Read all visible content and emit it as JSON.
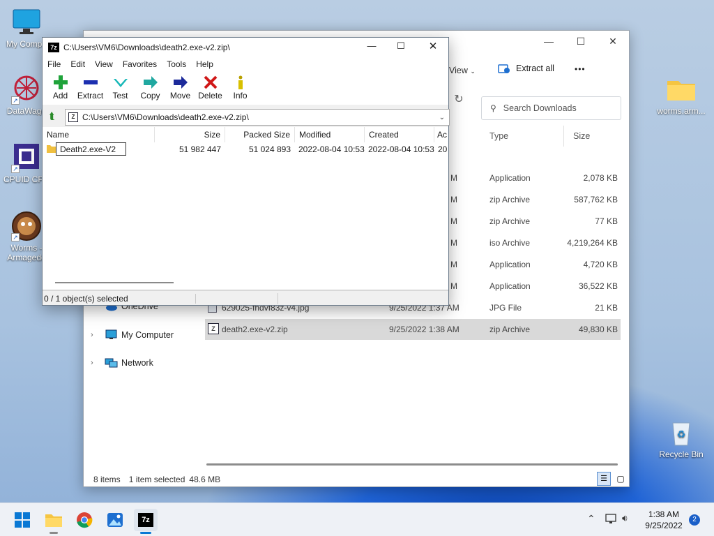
{
  "desktop": {
    "icons": [
      {
        "label": "My Compu"
      },
      {
        "label": "DataWago"
      },
      {
        "label": "CPUID CPU"
      },
      {
        "label": "Worms -"
      },
      {
        "label": "Armagedd"
      },
      {
        "label": "worms.arm..."
      },
      {
        "label": "Recycle Bin"
      }
    ]
  },
  "explorer": {
    "view_label": "View",
    "extract_all_label": "Extract all",
    "more_label": "•••",
    "search_placeholder": "Search Downloads",
    "columns": {
      "type": "Type",
      "size": "Size"
    },
    "rows": [
      {
        "date_tail": "M",
        "type": "Application",
        "size": "2,078 KB"
      },
      {
        "date_tail": "M",
        "type": "zip Archive",
        "size": "587,762 KB"
      },
      {
        "date_tail": "M",
        "type": "zip Archive",
        "size": "77 KB"
      },
      {
        "date_tail": "M",
        "type": "iso Archive",
        "size": "4,219,264 KB"
      },
      {
        "date_tail": "M",
        "type": "Application",
        "size": "4,720 KB"
      },
      {
        "date_tail": "M",
        "type": "Application",
        "size": "36,522 KB"
      },
      {
        "name": "629025-fhdvf83z-v4.jpg",
        "date": "9/25/2022 1:37 AM",
        "type": "JPG File",
        "size": "21 KB"
      },
      {
        "name": "death2.exe-v2.zip",
        "date": "9/25/2022 1:38 AM",
        "type": "zip Archive",
        "size": "49,830 KB"
      }
    ],
    "nav": {
      "onedrive": "OneDrive",
      "mycomputer": "My Computer",
      "network": "Network"
    },
    "status": {
      "items": "8 items",
      "selected": "1 item selected",
      "size": "48.6 MB"
    }
  },
  "zip": {
    "title": "C:\\Users\\VM6\\Downloads\\death2.exe-v2.zip\\",
    "menu": [
      "File",
      "Edit",
      "View",
      "Favorites",
      "Tools",
      "Help"
    ],
    "toolbar": {
      "add": "Add",
      "extract": "Extract",
      "test": "Test",
      "copy": "Copy",
      "move": "Move",
      "delete": "Delete",
      "info": "Info"
    },
    "address": "C:\\Users\\VM6\\Downloads\\death2.exe-v2.zip\\",
    "columns": {
      "name": "Name",
      "size": "Size",
      "packed": "Packed Size",
      "modified": "Modified",
      "created": "Created",
      "accessed": "Ac"
    },
    "row": {
      "name": "Death2.exe-V2",
      "size": "51 982 447",
      "packed": "51 024 893",
      "modified": "2022-08-04 10:53",
      "created": "2022-08-04 10:53",
      "accessed": "20"
    },
    "status": "0 / 1 object(s) selected"
  },
  "taskbar": {
    "time": "1:38 AM",
    "date": "9/25/2022",
    "badge": "2"
  }
}
